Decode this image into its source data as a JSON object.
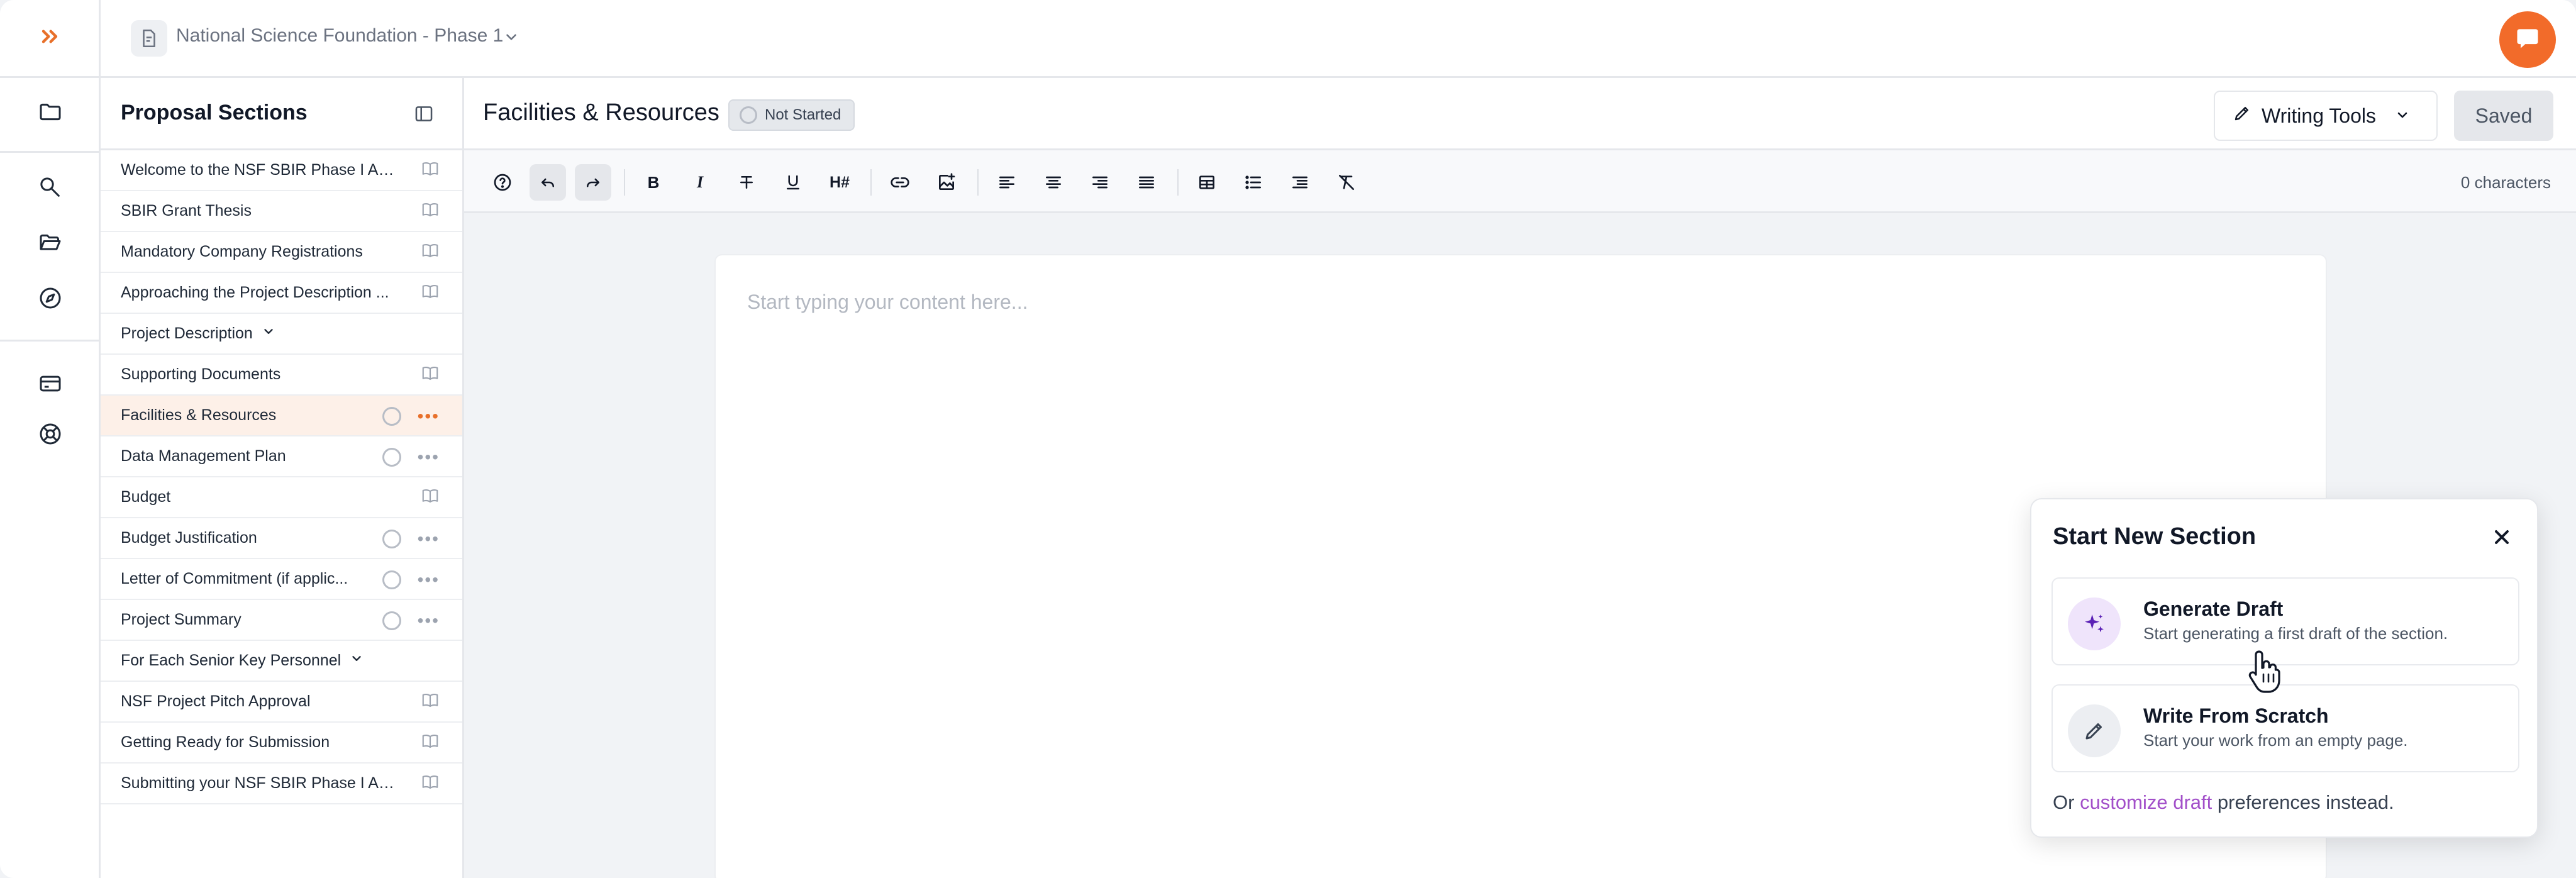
{
  "topbar": {
    "project_name": "National Science Foundation - Phase 1"
  },
  "sidebar": {
    "title": "Proposal Sections",
    "items": [
      {
        "label": "Welcome to the NSF SBIR Phase I Ap...",
        "right": "book"
      },
      {
        "label": "SBIR Grant Thesis",
        "right": "book"
      },
      {
        "label": "Mandatory Company Registrations",
        "right": "book"
      },
      {
        "label": "Approaching the Project Description ...",
        "right": "book"
      },
      {
        "label": "Project Description",
        "right": "chevron"
      },
      {
        "label": "Supporting Documents",
        "right": "book"
      },
      {
        "label": "Facilities & Resources",
        "right": "status",
        "active": true
      },
      {
        "label": "Data Management Plan",
        "right": "status"
      },
      {
        "label": "Budget",
        "right": "book"
      },
      {
        "label": "Budget Justification",
        "right": "status"
      },
      {
        "label": "Letter of Commitment (if applic...",
        "right": "status"
      },
      {
        "label": "Project Summary",
        "right": "status"
      },
      {
        "label": "For Each Senior Key Personnel",
        "right": "chevron"
      },
      {
        "label": "NSF Project Pitch Approval",
        "right": "book"
      },
      {
        "label": "Getting Ready for Submission",
        "right": "book"
      },
      {
        "label": "Submitting your NSF SBIR Phase I Ap...",
        "right": "book"
      }
    ]
  },
  "editor": {
    "title": "Facilities & Resources",
    "status": "Not Started",
    "writing_tools": "Writing Tools",
    "saved": "Saved",
    "char_count": "0 characters",
    "placeholder": "Start typing your content here...",
    "toolbar": {
      "bold": "B",
      "italic": "I",
      "heading": "H#"
    }
  },
  "popup": {
    "title": "Start New Section",
    "options": [
      {
        "title": "Generate Draft",
        "desc": "Start generating a first draft of the section."
      },
      {
        "title": "Write From Scratch",
        "desc": "Start your work from an empty page."
      }
    ],
    "footer_prefix": "Or",
    "footer_link": "customize draft",
    "footer_suffix": "preferences instead."
  },
  "colors": {
    "accent": "#f26b2a",
    "active_row": "#fdf0e8",
    "link": "#a24fc9",
    "generate_icon_bg": "#efe4fb"
  },
  "icons": {
    "rail": [
      "expand-icon",
      "folder-icon",
      "search-icon",
      "folder-open-icon",
      "compass-icon",
      "credit-card-icon",
      "help-buoy-icon"
    ]
  }
}
